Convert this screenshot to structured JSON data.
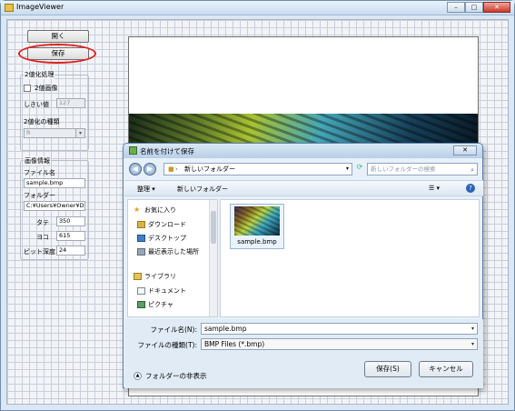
{
  "app": {
    "title": "ImageViewer",
    "window_buttons": [
      "–",
      "□",
      "✕"
    ]
  },
  "form": {
    "open_label": "開く",
    "save_label": "保存",
    "binarize": {
      "group_label": "2値化処理",
      "checkbox_label": "2値画像",
      "threshold_label": "しきい値",
      "threshold_value": "127",
      "type_label": "2値化の種類",
      "type_value": "R"
    },
    "info": {
      "group_label": "画像情報",
      "filename_label": "ファイル名",
      "filename_value": "sample.bmp",
      "folder_label": "フォルダー",
      "folder_value": "C:¥Users¥Owner¥De",
      "height_label": "タテ",
      "height_value": "350",
      "width_label": "ヨコ",
      "width_value": "615",
      "depth_label": "ビット深度",
      "depth_value": "24"
    }
  },
  "dialog": {
    "title": "名前を付けて保存",
    "close": "✕",
    "address": "新しいフォルダー",
    "search_placeholder": "新しいフォルダーの検索",
    "toolbar": {
      "organize": "整理 ▾",
      "new_folder": "新しいフォルダー",
      "view": "☰ ▾",
      "help": "?"
    },
    "nav": [
      {
        "label": "お気に入り",
        "icon": "star-icon"
      },
      {
        "label": "ダウンロード",
        "icon": "download-folder-icon"
      },
      {
        "label": "デスクトップ",
        "icon": "desktop-icon"
      },
      {
        "label": "最近表示した場所",
        "icon": "recent-places-icon"
      },
      {
        "label": "ライブラリ",
        "icon": "library-icon"
      },
      {
        "label": "ドキュメント",
        "icon": "documents-icon"
      },
      {
        "label": "ピクチャ",
        "icon": "pictures-icon"
      }
    ],
    "files": [
      {
        "name": "sample.bmp"
      }
    ],
    "filename_label": "ファイル名(N):",
    "filename_value": "sample.bmp",
    "filetype_label": "ファイルの種類(T):",
    "filetype_value": "BMP Files (*.bmp)",
    "hide_folders": "フォルダーの非表示",
    "save_button": "保存(S)",
    "cancel_button": "キャンセル"
  },
  "colors": {
    "highlight_ring": "#e0201b",
    "accent": "#5d7fa8"
  }
}
